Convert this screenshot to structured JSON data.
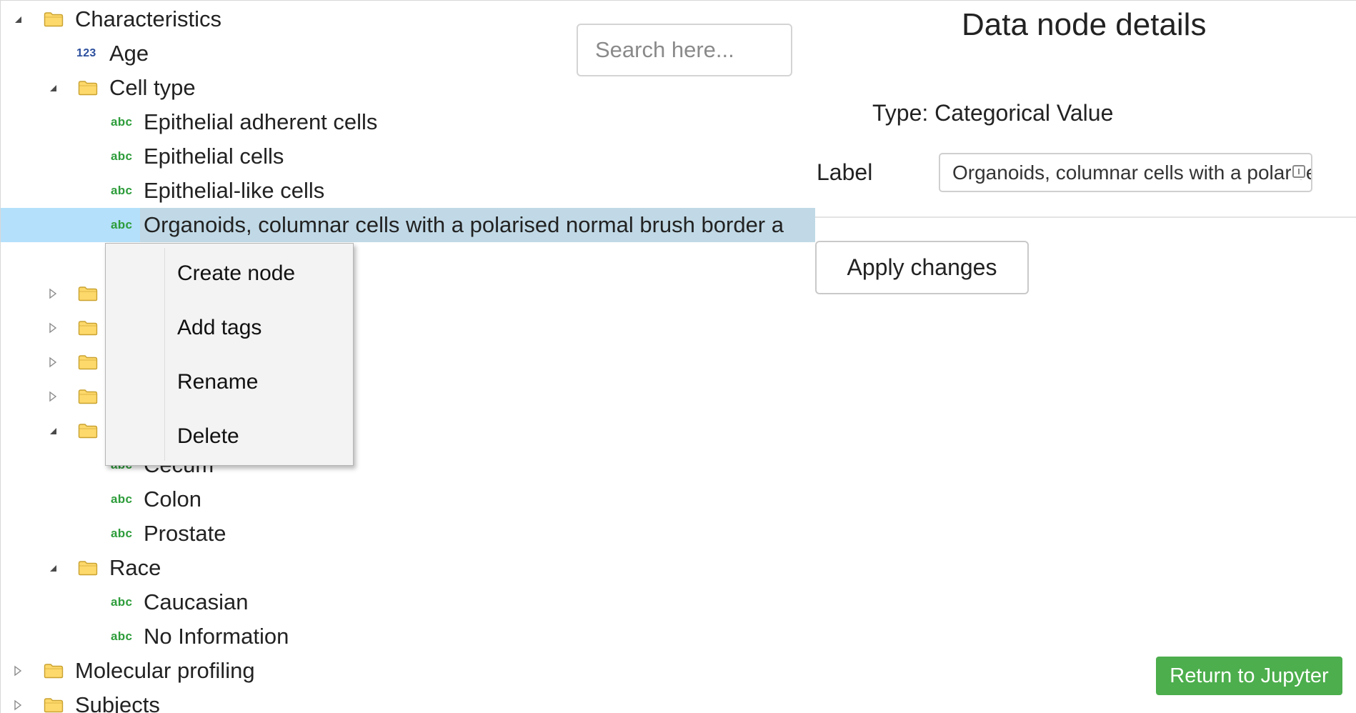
{
  "tree": {
    "rows": [
      {
        "label": "Characteristics",
        "icon": "folder",
        "toggle": "expanded"
      },
      {
        "label": "Age",
        "icon": "numeric-type",
        "type_badge": "123"
      },
      {
        "label": "Cell type",
        "icon": "folder",
        "toggle": "expanded"
      },
      {
        "label": "Epithelial adherent cells",
        "icon": "categorical-type",
        "type_badge": "abc"
      },
      {
        "label": "Epithelial cells",
        "icon": "categorical-type",
        "type_badge": "abc"
      },
      {
        "label": "Epithelial-like cells",
        "icon": "categorical-type",
        "type_badge": "abc"
      },
      {
        "label": "Organoids, columnar cells with a polarised normal brush border a",
        "icon": "categorical-type",
        "type_badge": "abc",
        "selected": true
      },
      {
        "label": "",
        "icon": "folder",
        "toggle": "collapsed"
      },
      {
        "label": "",
        "icon": "folder",
        "toggle": "collapsed"
      },
      {
        "label": "",
        "icon": "folder",
        "toggle": "collapsed"
      },
      {
        "label": "",
        "icon": "folder",
        "toggle": "collapsed"
      },
      {
        "label": "",
        "icon": "folder",
        "toggle": "expanded"
      },
      {
        "label": "Cecum",
        "icon": "categorical-type",
        "type_badge": "abc"
      },
      {
        "label": "Colon",
        "icon": "categorical-type",
        "type_badge": "abc"
      },
      {
        "label": "Prostate",
        "icon": "categorical-type",
        "type_badge": "abc"
      },
      {
        "label": "Race",
        "icon": "folder",
        "toggle": "expanded"
      },
      {
        "label": "Caucasian",
        "icon": "categorical-type",
        "type_badge": "abc"
      },
      {
        "label": "No Information",
        "icon": "categorical-type",
        "type_badge": "abc"
      },
      {
        "label": "Molecular profiling",
        "icon": "folder",
        "toggle": "collapsed"
      },
      {
        "label": "Subjects",
        "icon": "folder",
        "toggle": "collapsed"
      }
    ]
  },
  "context_menu": {
    "items": [
      "Create node",
      "Add tags",
      "Rename",
      "Delete"
    ]
  },
  "search": {
    "placeholder": "Search here..."
  },
  "details": {
    "title": "Data node details",
    "type_text": "Type: Categorical Value",
    "label_caption": "Label",
    "label_value": "Organoids, columnar cells with a polarised normal brush border a",
    "apply_label": "Apply changes"
  },
  "footer": {
    "jupyter_label": "Return to Jupyter"
  },
  "colors": {
    "selected_row": "#c1d9e6",
    "selected_row_left": "#b4e0fb",
    "abc_badge": "#2d9c3a",
    "numeric_badge": "#2c4f9e",
    "jupyter_button": "#4cae4c",
    "folder_fill": "#fdd86a",
    "folder_stroke": "#c9a230"
  }
}
